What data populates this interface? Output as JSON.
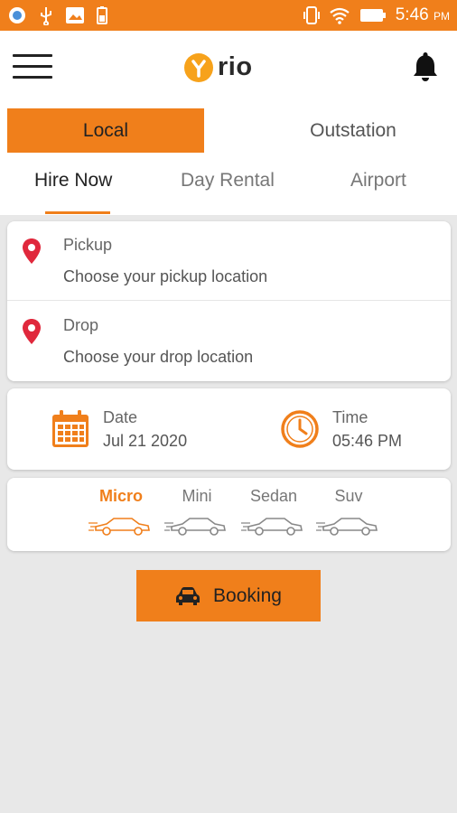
{
  "status_bar": {
    "time": "5:46",
    "ampm": "PM"
  },
  "header": {
    "logo_text": "rio"
  },
  "top_tabs": {
    "local": "Local",
    "outstation": "Outstation"
  },
  "sub_tabs": {
    "hire_now": "Hire Now",
    "day_rental": "Day Rental",
    "airport": "Airport"
  },
  "pickup": {
    "label": "Pickup",
    "placeholder": "Choose your pickup location"
  },
  "drop": {
    "label": "Drop",
    "placeholder": "Choose your drop location"
  },
  "date": {
    "label": "Date",
    "value": "Jul 21 2020"
  },
  "time": {
    "label": "Time",
    "value": "05:46 PM"
  },
  "car_types": [
    {
      "label": "Micro"
    },
    {
      "label": "Mini"
    },
    {
      "label": "Sedan"
    },
    {
      "label": "Suv"
    }
  ],
  "booking_button": {
    "label": "Booking"
  },
  "colors": {
    "accent": "#f07f1b",
    "pin": "#e0283c",
    "logo": "#f7a21b"
  },
  "icons": [
    "menu-icon",
    "bell-icon",
    "location-pin-icon",
    "calendar-icon",
    "clock-icon",
    "car-icon"
  ]
}
